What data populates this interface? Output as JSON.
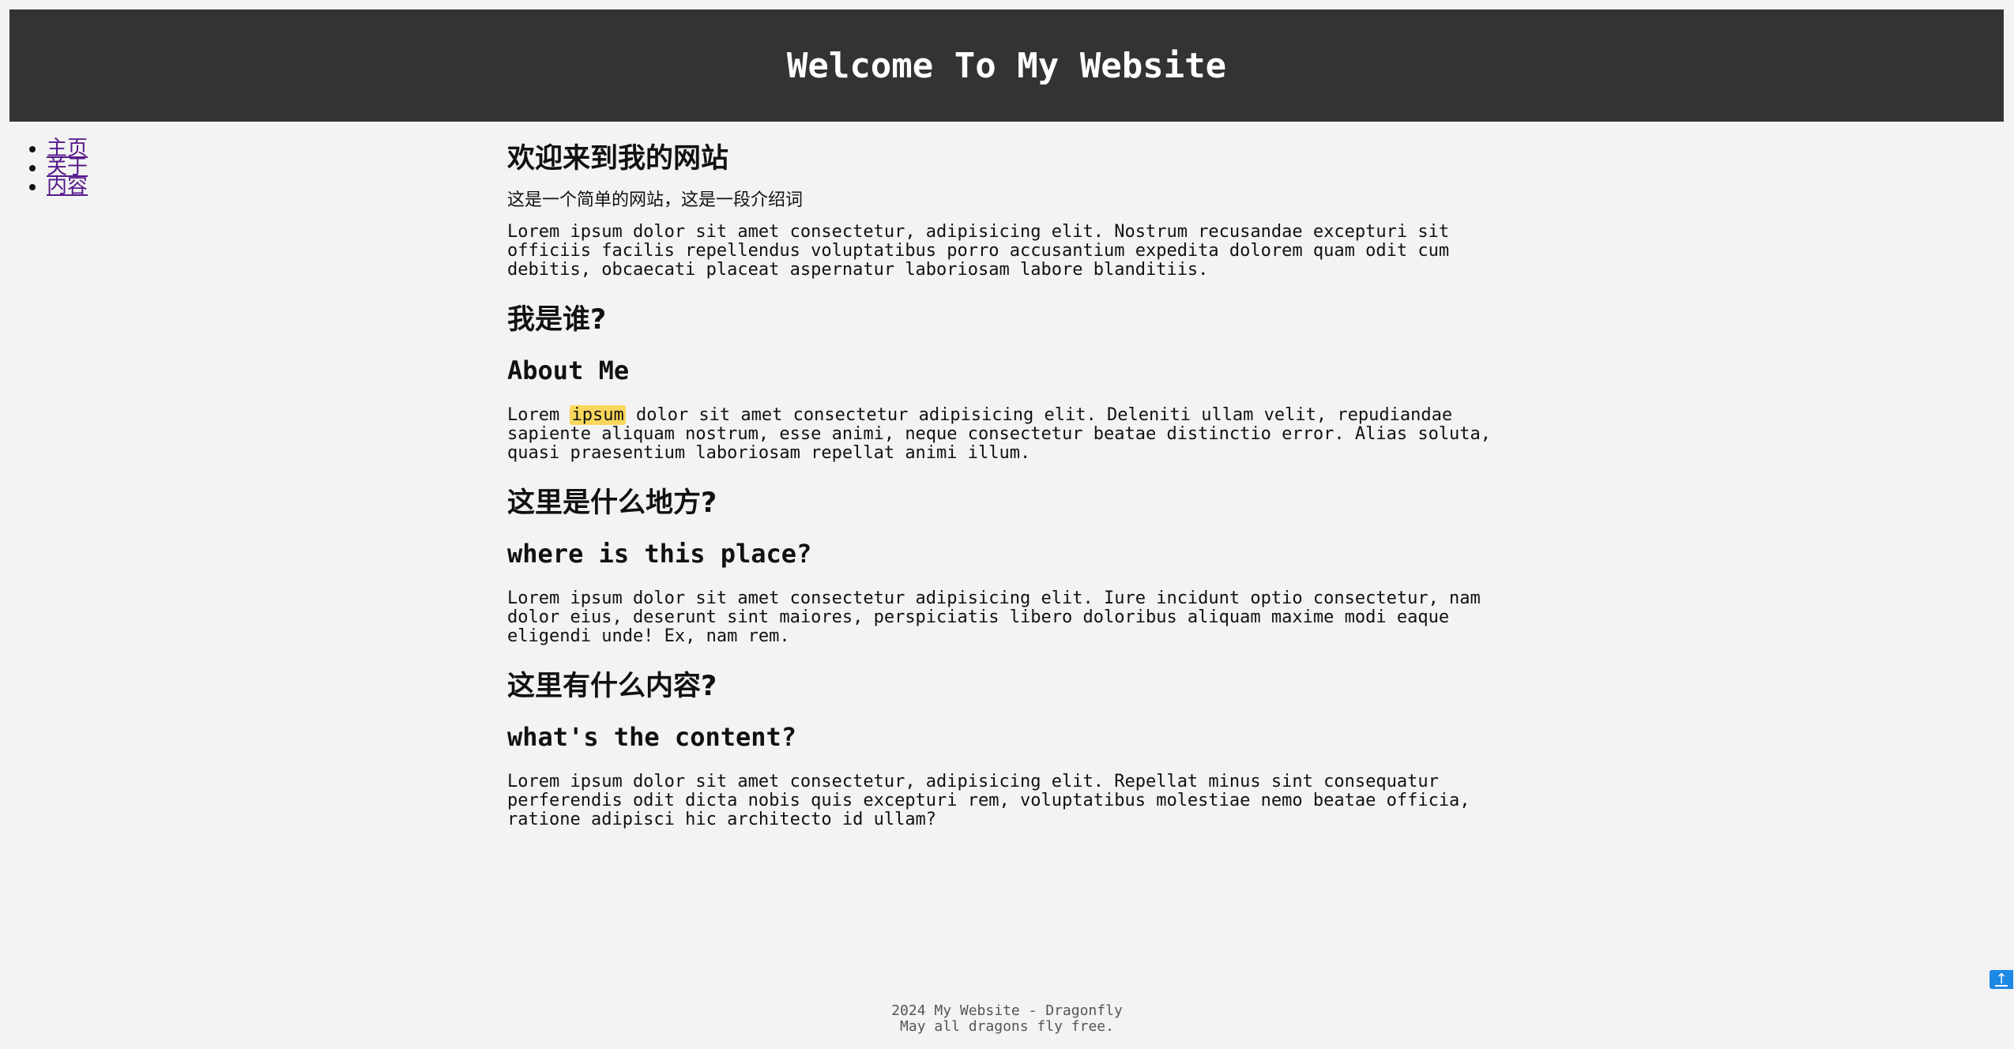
{
  "header": {
    "title": "Welcome To My Website"
  },
  "nav": {
    "items": [
      {
        "label": "主页"
      },
      {
        "label": "关于"
      },
      {
        "label": "内容"
      }
    ]
  },
  "main": {
    "welcome_heading": "欢迎来到我的网站",
    "intro_text": "这是一个简单的网站，这是一段介绍词",
    "intro_lorem": "Lorem ipsum dolor sit amet consectetur, adipisicing elit. Nostrum recusandae excepturi sit officiis facilis repellendus voluptatibus porro accusantium expedita dolorem quam odit cum debitis, obcaecati placeat aspernatur laboriosam labore blanditiis.",
    "sections": [
      {
        "heading_cn": "我是谁?",
        "heading_en": "About Me",
        "text_before_highlight": "Lorem ",
        "highlight": "ipsum",
        "text": " dolor sit amet consectetur adipisicing elit. Deleniti ullam velit, repudiandae sapiente aliquam nostrum, esse animi, neque consectetur beatae distinctio error. Alias soluta, quasi praesentium laboriosam repellat animi illum."
      },
      {
        "heading_cn": "这里是什么地方?",
        "heading_en": "where is this place?",
        "text": "Lorem ipsum dolor sit amet consectetur adipisicing elit. Iure incidunt optio consectetur, nam dolor eius, deserunt sint maiores, perspiciatis libero doloribus aliquam maxime modi eaque eligendi unde! Ex, nam rem."
      },
      {
        "heading_cn": "这里有什么内容?",
        "heading_en": "what's the content?",
        "text": "Lorem ipsum dolor sit amet consectetur, adipisicing elit. Repellat minus sint consequatur perferendis odit dicta nobis quis excepturi rem, voluptatibus molestiae nemo beatae officia, ratione adipisci hic architecto id ullam?"
      }
    ]
  },
  "footer": {
    "line1": "2024 My Website - Dragonfly",
    "line2": "May all dragons fly free."
  },
  "scroll_top": {
    "icon": "arrow-up-icon",
    "glyph": "↑"
  },
  "colors": {
    "header_bg": "#333333",
    "page_bg": "#f3f3f3",
    "link": "#551a8b",
    "highlight": "#f9d75c",
    "scroll_button": "#1e88e5"
  }
}
